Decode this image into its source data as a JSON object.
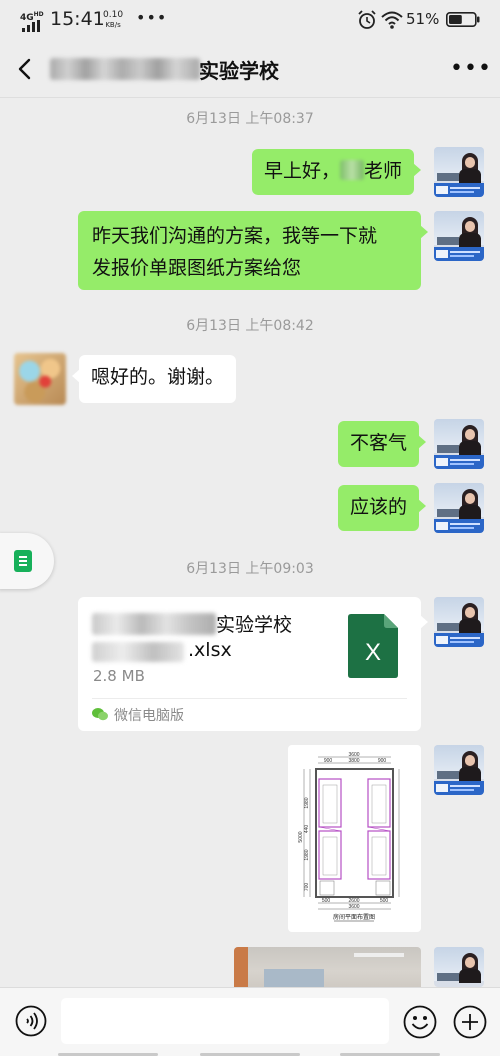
{
  "status_bar": {
    "network": "4G",
    "network_sup": "HD",
    "time": "15:41",
    "speed_value": "0.10",
    "speed_unit": "KB/s",
    "battery": "51%",
    "battery_level": 0.51
  },
  "header": {
    "title_visible": "实验学校",
    "more_label": "•••"
  },
  "messages": {
    "time1": "6月13日 上午08:37",
    "m1_pre": "早上好，",
    "m1_post": "老师",
    "m2_line1": "昨天我们沟通的方案，我等一下就",
    "m2_line2": "发报价单跟图纸方案给您",
    "time2": "6月13日 上午08:42",
    "m3": "嗯好的。谢谢。",
    "m4": "不客气",
    "m5": "应该的",
    "time3": "6月13日 上午09:03"
  },
  "file_card": {
    "name_line1_visible": "实验学校",
    "name_line2_visible": ".xlsx",
    "size": "2.8 MB",
    "source": "微信电脑版",
    "icon": "excel-file-icon",
    "icon_letter": "X"
  },
  "floor_plan": {
    "top_dim_total": "3600",
    "top_dim_left": "900",
    "top_dim_mid": "3800",
    "top_dim_right": "900",
    "bottom_dim_total": "3600",
    "bottom_dim_a": "500",
    "bottom_dim_b": "2600",
    "bottom_dim_c": "500",
    "side_total": "5000",
    "side_1": "1980",
    "side_2": "440",
    "side_3": "1980",
    "side_4": "700",
    "caption": "房间平面布置图"
  },
  "input": {
    "placeholder": ""
  },
  "icons": {
    "back": "back-arrow-icon",
    "voice": "voice-icon",
    "emoji": "emoji-icon",
    "plus": "plus-icon",
    "side_tab": "document-icon"
  },
  "colors": {
    "my_bubble": "#95ec69",
    "their_bubble": "#ffffff",
    "background": "#ededed",
    "excel_green": "#1d7144"
  }
}
